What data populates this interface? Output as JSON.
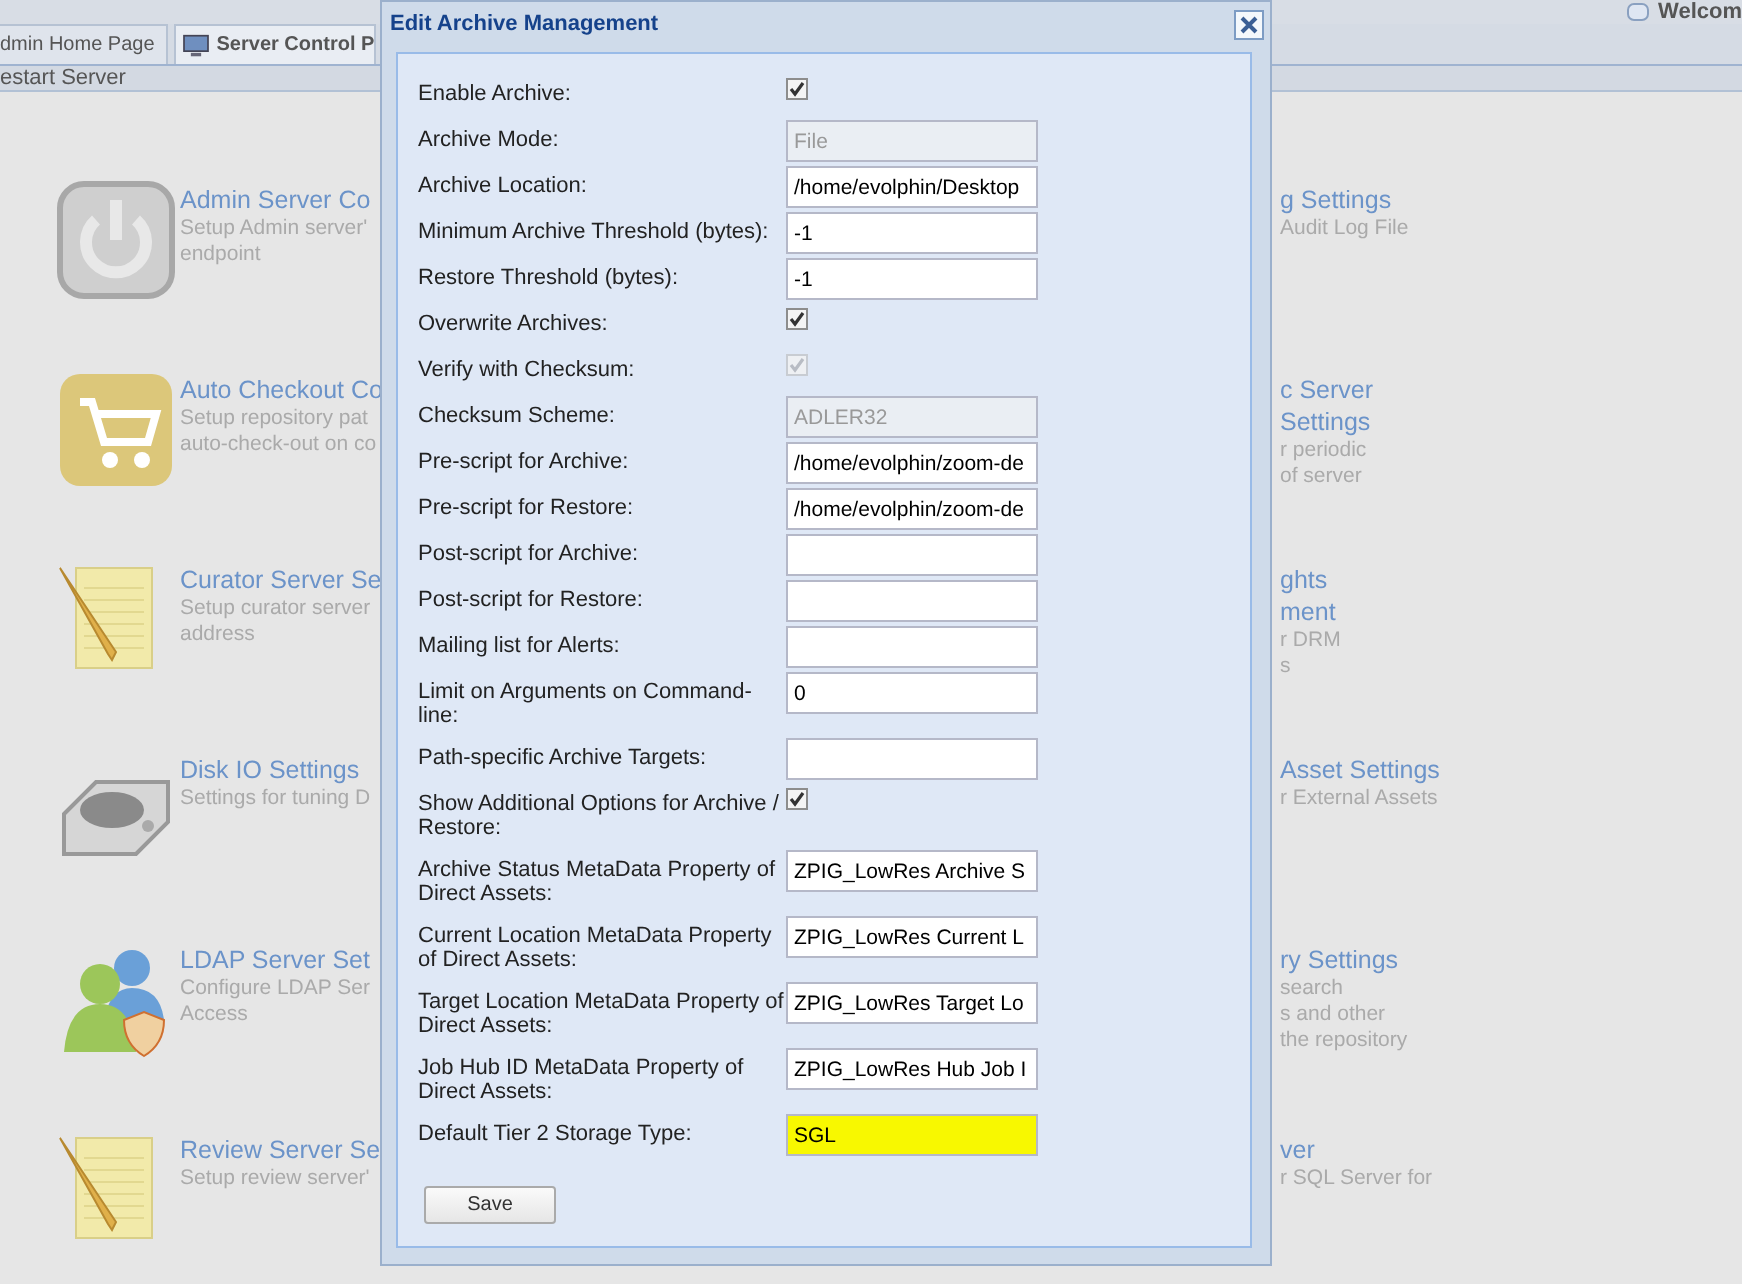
{
  "top_bar": {
    "welcome": "Welcom"
  },
  "tabs": [
    {
      "label": "dmin Home Page",
      "selected": false,
      "icon": false
    },
    {
      "label": "Server Control P",
      "selected": true,
      "icon": true
    }
  ],
  "toolbar": {
    "action": "estart Server"
  },
  "left_tiles": [
    {
      "kind": "power",
      "title": [
        "Admin Server Co"
      ],
      "description": [
        "Setup Admin server'",
        "endpoint"
      ]
    },
    {
      "kind": "cart",
      "title": [
        "Auto Checkout Co"
      ],
      "description": [
        "Setup repository pat",
        "auto-check-out on co"
      ]
    },
    {
      "kind": "notepad",
      "title": [
        "Curator Server Se"
      ],
      "description": [
        "Setup curator server",
        "address"
      ]
    },
    {
      "kind": "disk",
      "title": [
        "Disk IO Settings"
      ],
      "description": [
        "Settings for tuning D"
      ]
    },
    {
      "kind": "users",
      "title": [
        "LDAP Server Set"
      ],
      "description": [
        "Configure LDAP Ser",
        "Access"
      ]
    },
    {
      "kind": "notepad",
      "title": [
        "Review Server Se"
      ],
      "description": [
        "Setup review server'"
      ]
    }
  ],
  "right_tiles": [
    {
      "title": [
        "g Settings"
      ],
      "description": [
        "Audit Log File"
      ]
    },
    {
      "title": [
        "c Server",
        "Settings"
      ],
      "description": [
        "r periodic",
        "of server"
      ]
    },
    {
      "title": [
        "ghts",
        "ment"
      ],
      "description": [
        "r DRM",
        "s"
      ]
    },
    {
      "title": [
        "Asset Settings"
      ],
      "description": [
        "r External Assets"
      ]
    },
    {
      "title": [
        "ry Settings"
      ],
      "description": [
        "search",
        "s and other",
        "the repository"
      ]
    },
    {
      "title": [
        "ver"
      ],
      "description": [
        "r SQL Server for"
      ]
    }
  ],
  "dialog": {
    "title": "Edit Archive Management",
    "fields": [
      {
        "label": "Enable Archive:",
        "kind": "checkbox",
        "checked": true,
        "disabled": false
      },
      {
        "label": "Archive Mode:",
        "kind": "text",
        "value": "File",
        "disabled": true,
        "highlighted": false
      },
      {
        "label": "Archive Location:",
        "kind": "text",
        "value": "/home/evolphin/Desktop",
        "disabled": false,
        "highlighted": false
      },
      {
        "label": "Minimum Archive Threshold (bytes):",
        "kind": "text",
        "value": "-1",
        "disabled": false,
        "highlighted": false
      },
      {
        "label": "Restore Threshold (bytes):",
        "kind": "text",
        "value": "-1",
        "disabled": false,
        "highlighted": false
      },
      {
        "label": "Overwrite Archives:",
        "kind": "checkbox",
        "checked": true,
        "disabled": false
      },
      {
        "label": "Verify with Checksum:",
        "kind": "checkbox",
        "checked": true,
        "disabled": true
      },
      {
        "label": "Checksum Scheme:",
        "kind": "text",
        "value": "ADLER32",
        "disabled": true,
        "highlighted": false
      },
      {
        "label": "Pre-script for Archive:",
        "kind": "text",
        "value": "/home/evolphin/zoom-de",
        "disabled": false,
        "highlighted": false
      },
      {
        "label": "Pre-script for Restore:",
        "kind": "text",
        "value": "/home/evolphin/zoom-de",
        "disabled": false,
        "highlighted": false
      },
      {
        "label": "Post-script for Archive:",
        "kind": "text",
        "disabled": false,
        "highlighted": false
      },
      {
        "label": "Post-script for Restore:",
        "kind": "text",
        "disabled": false,
        "highlighted": false
      },
      {
        "label": "Mailing list for Alerts:",
        "kind": "text",
        "disabled": false,
        "highlighted": false
      },
      {
        "label": "Limit on Arguments on Command-line:",
        "kind": "text",
        "value": "0",
        "disabled": false,
        "highlighted": false
      },
      {
        "label": "Path-specific Archive Targets:",
        "kind": "text",
        "disabled": false,
        "highlighted": false
      },
      {
        "label": "Show Additional Options for Archive / Restore:",
        "kind": "checkbox",
        "checked": true,
        "disabled": false
      },
      {
        "label": "Archive Status MetaData Property of Direct Assets:",
        "kind": "text",
        "value": "ZPIG_LowRes Archive S",
        "disabled": false,
        "highlighted": false
      },
      {
        "label": "Current Location MetaData Property of Direct Assets:",
        "kind": "text",
        "value": "ZPIG_LowRes Current L",
        "disabled": false,
        "highlighted": false
      },
      {
        "label": "Target Location MetaData Property of Direct Assets:",
        "kind": "text",
        "value": "ZPIG_LowRes Target Lo",
        "disabled": false,
        "highlighted": false
      },
      {
        "label": "Job Hub ID MetaData Property of Direct Assets:",
        "kind": "text",
        "value": "ZPIG_LowRes Hub Job I",
        "disabled": false,
        "highlighted": false
      },
      {
        "label": "Default Tier 2 Storage Type:",
        "kind": "text",
        "value": "SGL",
        "disabled": false,
        "highlighted": true
      }
    ],
    "save_button": "Save"
  }
}
